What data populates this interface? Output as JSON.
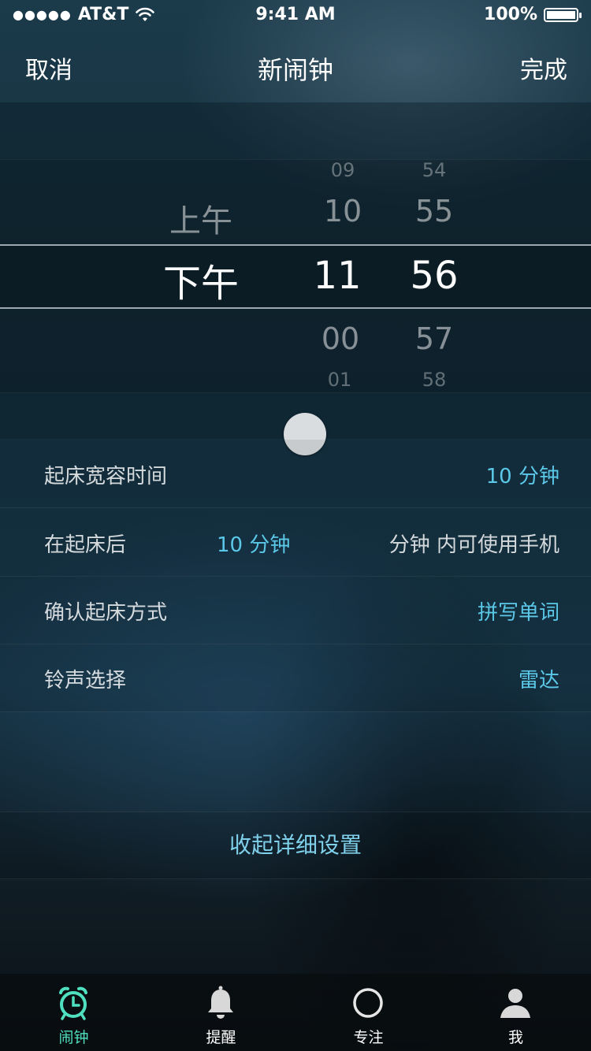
{
  "status_bar": {
    "signal_dots": "●●●●●",
    "carrier": "AT&T",
    "wifi_icon": "wifi-icon",
    "time": "9:41 AM",
    "battery_text": "100%"
  },
  "nav": {
    "cancel_label": "取消",
    "title": "新闹钟",
    "done_label": "完成"
  },
  "picker": {
    "period": {
      "above": "上午",
      "selected": "下午"
    },
    "hours": {
      "above2": "09",
      "above1": "10",
      "selected": "11",
      "below1": "00",
      "below2": "01"
    },
    "minutes": {
      "above2": "54",
      "above1": "55",
      "selected": "56",
      "below1": "57",
      "below2": "58"
    }
  },
  "settings": {
    "grace_time": {
      "label": "起床宽容时间",
      "value": "10 分钟"
    },
    "phone_use": {
      "label": "在起床后",
      "value": "10 分钟",
      "suffix": "分钟 内可使用手机"
    },
    "confirm_method": {
      "label": "确认起床方式",
      "value": "拼写单词"
    },
    "ringtone": {
      "label": "铃声选择",
      "value": "雷达"
    }
  },
  "collapse_label": "收起详细设置",
  "tabs": [
    {
      "label": "闹钟",
      "icon": "alarm-clock-icon",
      "active": true
    },
    {
      "label": "提醒",
      "icon": "bell-icon",
      "active": false
    },
    {
      "label": "专注",
      "icon": "circle-icon",
      "active": false
    },
    {
      "label": "我",
      "icon": "person-icon",
      "active": false
    }
  ],
  "colors": {
    "accent_value": "#5bc8e8",
    "accent_tab_active": "#4fe0c0"
  }
}
